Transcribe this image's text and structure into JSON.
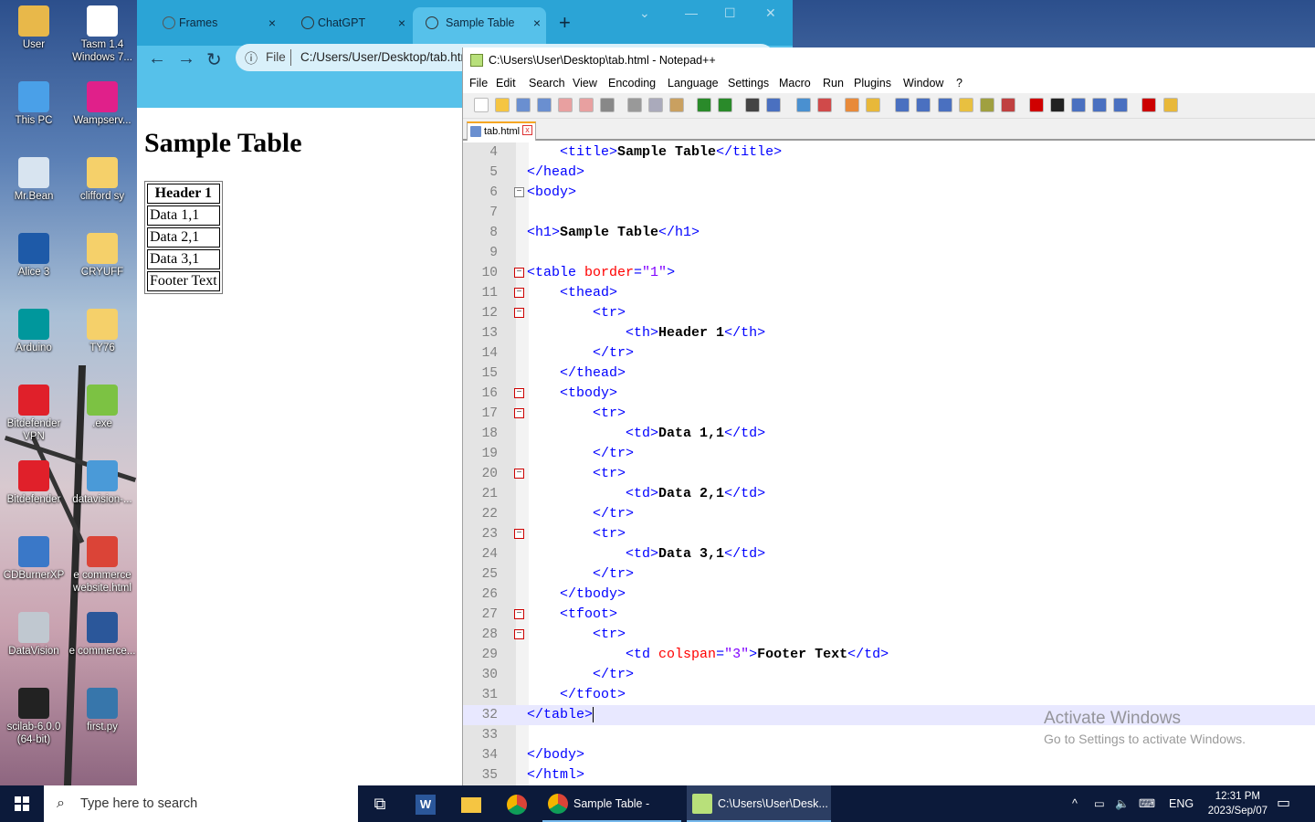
{
  "desktop": {
    "icons": [
      {
        "label": "User",
        "icon": "user-folder-icon",
        "color": "#e8b84a"
      },
      {
        "label": "Tasm 1.4 Windows 7...",
        "icon": "apple-icon",
        "color": "#ffffff"
      },
      {
        "label": "This PC",
        "icon": "computer-icon",
        "color": "#4aa0e8"
      },
      {
        "label": "Wampserv...",
        "icon": "wamp-icon",
        "color": "#e0208a"
      },
      {
        "label": "Mr.Bean",
        "icon": "recycle-bin-icon",
        "color": "#d8e4f0"
      },
      {
        "label": "clifford sy",
        "icon": "folder-icon",
        "color": "#f5d06a"
      },
      {
        "label": "Alice 3",
        "icon": "alice-icon",
        "color": "#1e5aa8"
      },
      {
        "label": "CRYUFF",
        "icon": "folder-icon",
        "color": "#f5d06a"
      },
      {
        "label": "Arduino",
        "icon": "arduino-icon",
        "color": "#00979c"
      },
      {
        "label": "TY76",
        "icon": "folder-icon",
        "color": "#f5d06a"
      },
      {
        "label": "Bitdefender VPN",
        "icon": "bitdefender-vpn-icon",
        "color": "#e0202a"
      },
      {
        "label": ".exe",
        "icon": "android-icon",
        "color": "#7cc243"
      },
      {
        "label": "Bitdefender",
        "icon": "bitdefender-icon",
        "color": "#e0202a"
      },
      {
        "label": "datavision-...",
        "icon": "installer-icon",
        "color": "#4a9ad8"
      },
      {
        "label": "CDBurnerXP",
        "icon": "cdburner-icon",
        "color": "#3a78c8"
      },
      {
        "label": "e commerce website.html",
        "icon": "chrome-icon",
        "color": "#db4437"
      },
      {
        "label": "DataVision",
        "icon": "datavision-icon",
        "color": "#c0c8d0"
      },
      {
        "label": "e commerce...",
        "icon": "word-doc-icon",
        "color": "#2b579a"
      },
      {
        "label": "scilab-6.0.0 (64-bit)",
        "icon": "scilab-icon",
        "color": "#222222"
      },
      {
        "label": "first.py",
        "icon": "python-icon",
        "color": "#3776ab"
      }
    ]
  },
  "browser": {
    "tabs": [
      {
        "label": "Frames",
        "close": "×"
      },
      {
        "label": "ChatGPT",
        "close": "×"
      },
      {
        "label": "Sample Table",
        "close": "×"
      }
    ],
    "new_tab": "+",
    "address": {
      "scheme_label": "File",
      "url": "C:/Users/User/Desktop/tab.html"
    },
    "page": {
      "heading": "Sample Table",
      "table": {
        "header": "Header 1",
        "rows": [
          "Data 1,1",
          "Data 2,1",
          "Data 3,1"
        ],
        "footer": "Footer Text"
      }
    }
  },
  "notepad": {
    "title": "C:\\Users\\User\\Desktop\\tab.html - Notepad++",
    "menu": [
      "File",
      "Edit",
      "Search",
      "View",
      "Encoding",
      "Language",
      "Settings",
      "Macro",
      "Run",
      "Plugins",
      "Window",
      "?"
    ],
    "file_tab": "tab.html",
    "current_line": 32,
    "lines": [
      {
        "n": 4,
        "fold": "",
        "parts": [
          [
            "i",
            "    "
          ],
          [
            "tag",
            "<title>"
          ],
          [
            "txt",
            "Sample Table"
          ],
          [
            "tag",
            "</title>"
          ]
        ]
      },
      {
        "n": 5,
        "fold": "",
        "parts": [
          [
            "tag",
            "</head>"
          ]
        ]
      },
      {
        "n": 6,
        "fold": "minus",
        "parts": [
          [
            "tag",
            "<body>"
          ]
        ]
      },
      {
        "n": 7,
        "fold": "",
        "parts": []
      },
      {
        "n": 8,
        "fold": "",
        "parts": [
          [
            "tag",
            "<h1>"
          ],
          [
            "txt",
            "Sample Table"
          ],
          [
            "tag",
            "</h1>"
          ]
        ]
      },
      {
        "n": 9,
        "fold": "",
        "parts": []
      },
      {
        "n": 10,
        "fold": "minus-red",
        "parts": [
          [
            "tag",
            "<table "
          ],
          [
            "attr",
            "border"
          ],
          [
            "tag",
            "="
          ],
          [
            "val",
            "\"1\""
          ],
          [
            "tag",
            ">"
          ]
        ]
      },
      {
        "n": 11,
        "fold": "minus-red",
        "parts": [
          [
            "i",
            "    "
          ],
          [
            "tag",
            "<thead>"
          ]
        ]
      },
      {
        "n": 12,
        "fold": "minus-red",
        "parts": [
          [
            "i",
            "        "
          ],
          [
            "tag",
            "<tr>"
          ]
        ]
      },
      {
        "n": 13,
        "fold": "",
        "parts": [
          [
            "i",
            "            "
          ],
          [
            "tag",
            "<th>"
          ],
          [
            "txt",
            "Header 1"
          ],
          [
            "tag",
            "</th>"
          ]
        ]
      },
      {
        "n": 14,
        "fold": "",
        "parts": [
          [
            "i",
            "        "
          ],
          [
            "tag",
            "</tr>"
          ]
        ]
      },
      {
        "n": 15,
        "fold": "",
        "parts": [
          [
            "i",
            "    "
          ],
          [
            "tag",
            "</thead>"
          ]
        ]
      },
      {
        "n": 16,
        "fold": "minus-red",
        "parts": [
          [
            "i",
            "    "
          ],
          [
            "tag",
            "<tbody>"
          ]
        ]
      },
      {
        "n": 17,
        "fold": "minus-red",
        "parts": [
          [
            "i",
            "        "
          ],
          [
            "tag",
            "<tr>"
          ]
        ]
      },
      {
        "n": 18,
        "fold": "",
        "parts": [
          [
            "i",
            "            "
          ],
          [
            "tag",
            "<td>"
          ],
          [
            "txt",
            "Data 1,1"
          ],
          [
            "tag",
            "</td>"
          ]
        ]
      },
      {
        "n": 19,
        "fold": "",
        "parts": [
          [
            "i",
            "        "
          ],
          [
            "tag",
            "</tr>"
          ]
        ]
      },
      {
        "n": 20,
        "fold": "minus-red",
        "parts": [
          [
            "i",
            "        "
          ],
          [
            "tag",
            "<tr>"
          ]
        ]
      },
      {
        "n": 21,
        "fold": "",
        "parts": [
          [
            "i",
            "            "
          ],
          [
            "tag",
            "<td>"
          ],
          [
            "txt",
            "Data 2,1"
          ],
          [
            "tag",
            "</td>"
          ]
        ]
      },
      {
        "n": 22,
        "fold": "",
        "parts": [
          [
            "i",
            "        "
          ],
          [
            "tag",
            "</tr>"
          ]
        ]
      },
      {
        "n": 23,
        "fold": "minus-red",
        "parts": [
          [
            "i",
            "        "
          ],
          [
            "tag",
            "<tr>"
          ]
        ]
      },
      {
        "n": 24,
        "fold": "",
        "parts": [
          [
            "i",
            "            "
          ],
          [
            "tag",
            "<td>"
          ],
          [
            "txt",
            "Data 3,1"
          ],
          [
            "tag",
            "</td>"
          ]
        ]
      },
      {
        "n": 25,
        "fold": "",
        "parts": [
          [
            "i",
            "        "
          ],
          [
            "tag",
            "</tr>"
          ]
        ]
      },
      {
        "n": 26,
        "fold": "",
        "parts": [
          [
            "i",
            "    "
          ],
          [
            "tag",
            "</tbody>"
          ]
        ]
      },
      {
        "n": 27,
        "fold": "minus-red",
        "parts": [
          [
            "i",
            "    "
          ],
          [
            "tag",
            "<tfoot>"
          ]
        ]
      },
      {
        "n": 28,
        "fold": "minus-red",
        "parts": [
          [
            "i",
            "        "
          ],
          [
            "tag",
            "<tr>"
          ]
        ]
      },
      {
        "n": 29,
        "fold": "",
        "parts": [
          [
            "i",
            "            "
          ],
          [
            "tag",
            "<td "
          ],
          [
            "attr",
            "colspan"
          ],
          [
            "tag",
            "="
          ],
          [
            "val",
            "\"3\""
          ],
          [
            "tag",
            ">"
          ],
          [
            "txt",
            "Footer Text"
          ],
          [
            "tag",
            "</td>"
          ]
        ]
      },
      {
        "n": 30,
        "fold": "",
        "parts": [
          [
            "i",
            "        "
          ],
          [
            "tag",
            "</tr>"
          ]
        ]
      },
      {
        "n": 31,
        "fold": "",
        "parts": [
          [
            "i",
            "    "
          ],
          [
            "tag",
            "</tfoot>"
          ]
        ]
      },
      {
        "n": 32,
        "fold": "",
        "parts": [
          [
            "tag",
            "</table>"
          ]
        ]
      },
      {
        "n": 33,
        "fold": "",
        "parts": []
      },
      {
        "n": 34,
        "fold": "",
        "parts": [
          [
            "tag",
            "</body>"
          ]
        ]
      },
      {
        "n": 35,
        "fold": "",
        "parts": [
          [
            "tag",
            "</html>"
          ]
        ]
      }
    ]
  },
  "watermark": {
    "line1": "Activate Windows",
    "line2": "Go to Settings to activate Windows."
  },
  "taskbar": {
    "search_placeholder": "Type here to search",
    "apps": [
      {
        "label": "Sample Table - Goo...",
        "icon": "chrome-icon"
      },
      {
        "label": "C:\\Users\\User\\Desk...",
        "icon": "notepadpp-icon"
      }
    ],
    "language": "ENG",
    "time": "12:31 PM",
    "date": "2023/Sep/07"
  },
  "colors": {
    "browser_tabbar": "#2ba4d6",
    "browser_toolbar": "#56c1ea",
    "taskbar": "#0c1a3a",
    "npp_tag": "#0000ff",
    "npp_attr": "#ff0000",
    "npp_value": "#8000ff"
  }
}
